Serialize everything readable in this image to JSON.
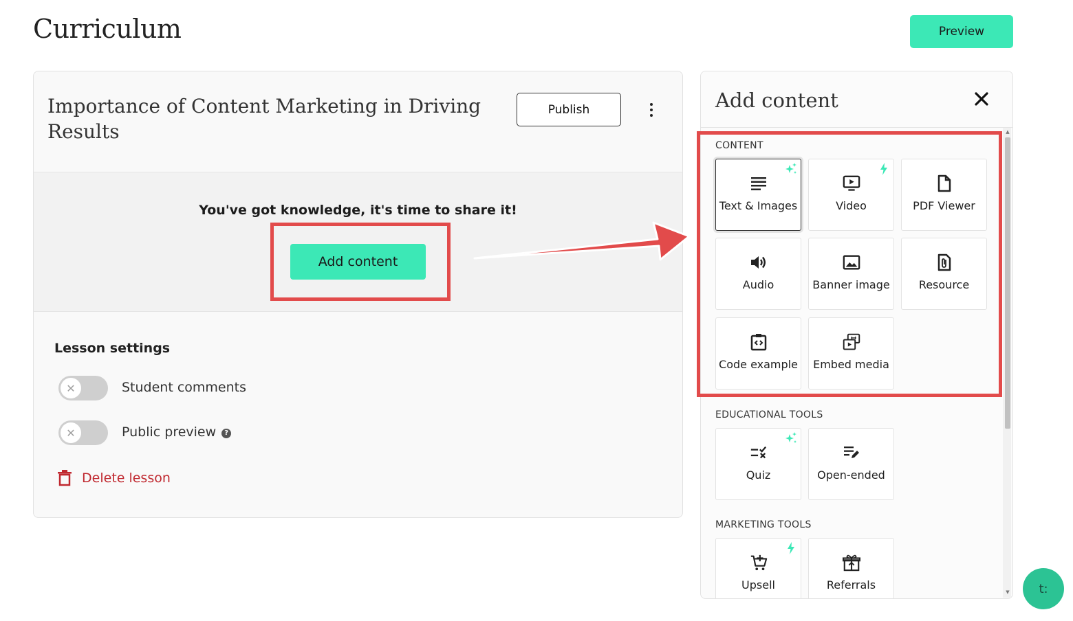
{
  "page": {
    "title": "Curriculum",
    "preview_label": "Preview"
  },
  "lesson": {
    "title": "Importance of Content Marketing in Driving Results",
    "publish_label": "Publish",
    "empty_text": "You've got knowledge, it's time to share it!",
    "add_content_label": "Add content"
  },
  "settings": {
    "title": "Lesson settings",
    "student_comments": "Student comments",
    "public_preview": "Public preview",
    "help_glyph": "?",
    "delete_label": "Delete lesson"
  },
  "panel": {
    "title": "Add content",
    "sections": {
      "content": "CONTENT",
      "educational": "EDUCATIONAL TOOLS",
      "marketing": "MARKETING TOOLS"
    },
    "content_items": [
      "Text & Images",
      "Video",
      "PDF Viewer",
      "Audio",
      "Banner image",
      "Resource",
      "Code example",
      "Embed media"
    ],
    "educational_items": [
      "Quiz",
      "Open-ended"
    ],
    "marketing_items": [
      "Upsell",
      "Referrals"
    ]
  },
  "chat": {
    "label": "t:"
  },
  "colors": {
    "accent": "#3ce8b6",
    "highlight": "#e24b4b",
    "danger": "#c0282f",
    "badge": "#3ce8b6"
  },
  "icons": {
    "text_images": "lines-icon",
    "video": "monitor-play-icon",
    "pdf": "file-icon",
    "audio": "speaker-icon",
    "banner": "image-icon",
    "resource": "paperclip-file-icon",
    "code": "code-clipboard-icon",
    "embed": "embed-media-icon",
    "quiz": "quiz-icon",
    "open_ended": "edit-lines-icon",
    "upsell": "cart-plus-icon",
    "referrals": "gift-icon"
  }
}
